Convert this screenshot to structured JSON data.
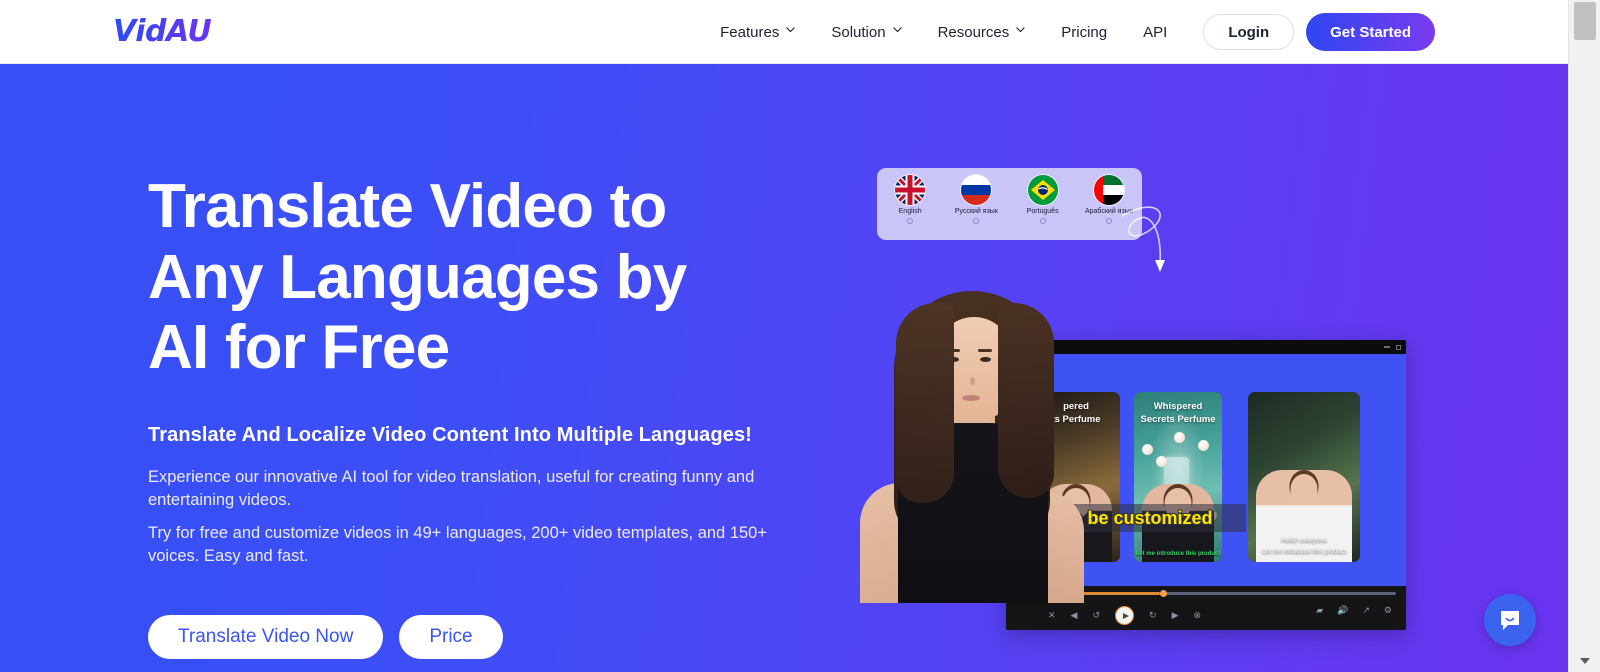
{
  "header": {
    "logo": "VidAU",
    "nav_items": [
      {
        "label": "Features",
        "has_chevron": true
      },
      {
        "label": "Solution",
        "has_chevron": true
      },
      {
        "label": "Resources",
        "has_chevron": true
      },
      {
        "label": "Pricing",
        "has_chevron": false
      },
      {
        "label": "API",
        "has_chevron": false
      }
    ],
    "login_label": "Login",
    "get_started_label": "Get Started"
  },
  "hero": {
    "headline": "Translate Video to Any Languages by AI for Free",
    "subheadline": "Translate And Localize Video Content Into Multiple Languages!",
    "paragraph_1": "Experience our innovative AI tool for video translation, useful for creating funny and entertaining videos.",
    "paragraph_2": "Try for free and customize videos in 49+ languages, 200+ video templates, and 150+ voices. Easy and fast.",
    "cta_primary": "Translate Video Now",
    "cta_secondary": "Price"
  },
  "languages": [
    {
      "label": "English",
      "flag": "uk-flag-icon"
    },
    {
      "label": "Русский язык",
      "flag": "russia-flag-icon"
    },
    {
      "label": "Português",
      "flag": "brazil-flag-icon"
    },
    {
      "label": "Арабский язык",
      "flag": "uae-flag-icon"
    }
  ],
  "video_demo": {
    "card_title": "Whispered Secrets Perfume",
    "card_title_line1": "Whispered",
    "card_title_line2": "Secrets Perfume",
    "card1_title_line1": "pered",
    "card1_title_line2": "ts Perfume",
    "yellow_caption": "ady to be customized",
    "caption_green": "Let me introduce this product",
    "caption_greeting": "Hello! everyone",
    "caption_intro": "Let me introduce this product",
    "progress_percent": "38"
  },
  "chat": {
    "icon": "chat-bubble-smiley-icon"
  },
  "colors": {
    "gradient_start": "#3450f6",
    "gradient_end": "#6a33ef",
    "accent_blue": "#3a55f2",
    "caption_yellow": "#ffe600",
    "player_orange": "#e08a34"
  }
}
